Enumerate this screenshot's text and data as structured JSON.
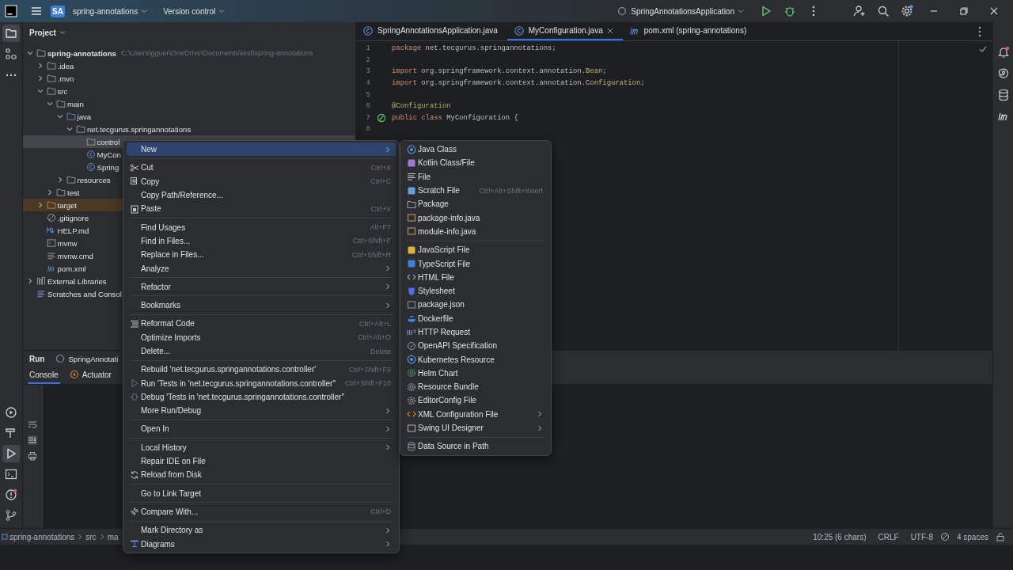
{
  "topbar": {
    "project_badge": "SA",
    "project": "spring-annotations",
    "vcs": "Version control",
    "run_config": "SpringAnnotationsApplication"
  },
  "left_tools": {
    "top": [
      {
        "selected": true
      },
      {
        "selected": false
      }
    ],
    "bottom": [
      {
        "selected": false
      },
      {
        "selected": false
      },
      {
        "selected": true
      },
      {
        "selected": false
      },
      {
        "selected": false
      },
      {
        "selected": false
      }
    ]
  },
  "project_panel": {
    "title": "Project",
    "tree": [
      {
        "name": "spring-annotations",
        "path": "C:\\Users\\gguer\\OneDrive\\Documents\\test\\spring-annotations",
        "kind": "module",
        "expanded": true,
        "selected": false,
        "children": [
          {
            "name": ".idea",
            "kind": "folder",
            "expanded": false,
            "selected": false
          },
          {
            "name": ".mvn",
            "kind": "folder",
            "expanded": false,
            "selected": false
          },
          {
            "name": "src",
            "kind": "folder",
            "expanded": true,
            "selected": false,
            "children": [
              {
                "name": "main",
                "kind": "folder",
                "expanded": true,
                "selected": false,
                "children": [
                  {
                    "name": "java",
                    "kind": "source",
                    "expanded": true,
                    "selected": false,
                    "children": [
                      {
                        "name": "net.tecgurus.springannotations",
                        "kind": "package",
                        "expanded": true,
                        "selected": false,
                        "children": [
                          {
                            "name": "control",
                            "kind": "package",
                            "selected": true
                          },
                          {
                            "name": "MyCon",
                            "kind": "class",
                            "selected": false
                          },
                          {
                            "name": "Spring",
                            "kind": "spring",
                            "selected": false
                          }
                        ]
                      }
                    ]
                  },
                  {
                    "name": "resources",
                    "kind": "resources",
                    "expanded": false,
                    "selected": false
                  }
                ]
              },
              {
                "name": "test",
                "kind": "folder",
                "expanded": false,
                "selected": false
              }
            ]
          },
          {
            "name": "target",
            "kind": "excluded",
            "expanded": false,
            "selected": false
          },
          {
            "name": ".gitignore",
            "kind": "ignore",
            "selected": false
          },
          {
            "name": "HELP.md",
            "kind": "markdown",
            "selected": false
          },
          {
            "name": "mvnw",
            "kind": "script",
            "selected": false
          },
          {
            "name": "mvnw.cmd",
            "kind": "text",
            "selected": false
          },
          {
            "name": "pom.xml",
            "kind": "maven",
            "selected": false
          }
        ]
      },
      {
        "name": "External Libraries",
        "kind": "library",
        "expanded": false,
        "selected": false
      },
      {
        "name": "Scratches and Consol",
        "kind": "scratches",
        "selected": false
      }
    ]
  },
  "editor": {
    "tabs": [
      {
        "label": "SpringAnnotationsApplication.java",
        "kind": "spring",
        "selected": false
      },
      {
        "label": "MyConfiguration.java",
        "kind": "class",
        "selected": true
      },
      {
        "label": "pom.xml (spring-annotations)",
        "kind": "maven",
        "selected": false
      }
    ],
    "lines": [
      {
        "number": "1",
        "tokens": [
          {
            "text": "package ",
            "kind": "keyword"
          },
          {
            "text": "net.tecgurus.springannotations;",
            "kind": "plain"
          }
        ]
      },
      {
        "number": "2"
      },
      {
        "number": "3",
        "tokens": [
          {
            "text": "import ",
            "kind": "keyword"
          },
          {
            "text": "org.springframework.context.annotation.",
            "kind": "plain"
          },
          {
            "text": "Bean",
            "kind": "type"
          },
          {
            "text": ";",
            "kind": "plain"
          }
        ]
      },
      {
        "number": "4",
        "tokens": [
          {
            "text": "import ",
            "kind": "keyword"
          },
          {
            "text": "org.springframework.context.annotation.",
            "kind": "plain"
          },
          {
            "text": "Configuration",
            "kind": "type"
          },
          {
            "text": ";",
            "kind": "plain"
          }
        ]
      },
      {
        "number": "5"
      },
      {
        "number": "6",
        "tokens": [
          {
            "text": "@Configuration",
            "kind": "annotation"
          }
        ]
      },
      {
        "number": "7",
        "tokens": [
          {
            "text": "public class ",
            "kind": "keyword"
          },
          {
            "text": "MyConfiguration {",
            "kind": "plain"
          }
        ],
        "bean": true
      },
      {
        "number": "8"
      }
    ]
  },
  "run_panel": {
    "title": "Run",
    "run_tab": "SpringAnnotati",
    "tabs": [
      {
        "label": "Console",
        "selected": true
      },
      {
        "label": "Actuator",
        "selected": false
      }
    ]
  },
  "status_bar": {
    "breadcrumbs": [
      "spring-annotations",
      "src",
      "ma"
    ],
    "position": "10:25 (6 chars)",
    "line_separator": "CRLF",
    "encoding": "UTF-8",
    "indent": "4 spaces"
  },
  "context_menu": {
    "items": [
      {
        "kind": "item",
        "label": "New",
        "submenu": true,
        "selected": true
      },
      {
        "kind": "separator"
      },
      {
        "kind": "item",
        "label": "Cut",
        "shortcut": "Ctrl+X",
        "submenu": false,
        "selected": false
      },
      {
        "kind": "item",
        "label": "Copy",
        "shortcut": "Ctrl+C",
        "submenu": false,
        "selected": false
      },
      {
        "kind": "item",
        "label": "Copy Path/Reference...",
        "submenu": false,
        "selected": false
      },
      {
        "kind": "item",
        "label": "Paste",
        "shortcut": "Ctrl+V",
        "submenu": false,
        "selected": false
      },
      {
        "kind": "separator"
      },
      {
        "kind": "item",
        "label": "Find Usages",
        "shortcut": "Alt+F7",
        "submenu": false,
        "selected": false
      },
      {
        "kind": "item",
        "label": "Find in Files...",
        "shortcut": "Ctrl+Shift+F",
        "submenu": false,
        "selected": false
      },
      {
        "kind": "item",
        "label": "Replace in Files...",
        "shortcut": "Ctrl+Shift+R",
        "submenu": false,
        "selected": false
      },
      {
        "kind": "item",
        "label": "Analyze",
        "submenu": true,
        "selected": false
      },
      {
        "kind": "separator"
      },
      {
        "kind": "item",
        "label": "Refactor",
        "submenu": true,
        "selected": false
      },
      {
        "kind": "separator"
      },
      {
        "kind": "item",
        "label": "Bookmarks",
        "submenu": true,
        "selected": false
      },
      {
        "kind": "separator"
      },
      {
        "kind": "item",
        "label": "Reformat Code",
        "shortcut": "Ctrl+Alt+L",
        "submenu": false,
        "selected": false
      },
      {
        "kind": "item",
        "label": "Optimize Imports",
        "shortcut": "Ctrl+Alt+O",
        "submenu": false,
        "selected": false
      },
      {
        "kind": "item",
        "label": "Delete...",
        "shortcut": "Delete",
        "submenu": false,
        "selected": false
      },
      {
        "kind": "separator"
      },
      {
        "kind": "item",
        "label": "Rebuild 'net.tecgurus.springannotations.controller'",
        "shortcut": "Ctrl+Shift+F9",
        "submenu": false,
        "selected": false
      },
      {
        "kind": "item",
        "label": "Run 'Tests in 'net.tecgurus.springannotations.controller''",
        "shortcut": "Ctrl+Shift+F10",
        "submenu": false,
        "selected": false
      },
      {
        "kind": "item",
        "label": "Debug 'Tests in 'net.tecgurus.springannotations.controller''",
        "submenu": false,
        "selected": false
      },
      {
        "kind": "item",
        "label": "More Run/Debug",
        "submenu": true,
        "selected": false
      },
      {
        "kind": "separator"
      },
      {
        "kind": "item",
        "label": "Open In",
        "submenu": true,
        "selected": false
      },
      {
        "kind": "separator"
      },
      {
        "kind": "item",
        "label": "Local History",
        "submenu": true,
        "selected": false
      },
      {
        "kind": "item",
        "label": "Repair IDE on File",
        "submenu": false,
        "selected": false
      },
      {
        "kind": "item",
        "label": "Reload from Disk",
        "submenu": false,
        "selected": false
      },
      {
        "kind": "separator"
      },
      {
        "kind": "item",
        "label": "Go to Link Target",
        "submenu": false,
        "selected": false
      },
      {
        "kind": "separator"
      },
      {
        "kind": "item",
        "label": "Compare With...",
        "shortcut": "Ctrl+D",
        "submenu": false,
        "selected": false
      },
      {
        "kind": "separator"
      },
      {
        "kind": "item",
        "label": "Mark Directory as",
        "submenu": true,
        "selected": false
      },
      {
        "kind": "item",
        "label": "Diagrams",
        "submenu": true,
        "selected": false
      }
    ]
  },
  "new_submenu": {
    "items": [
      {
        "kind": "item",
        "label": "Java Class",
        "submenu": false,
        "selected": false
      },
      {
        "kind": "item",
        "label": "Kotlin Class/File",
        "submenu": false,
        "selected": false
      },
      {
        "kind": "item",
        "label": "File",
        "submenu": false,
        "selected": false
      },
      {
        "kind": "item",
        "label": "Scratch File",
        "shortcut": "Ctrl+Alt+Shift+Insert",
        "submenu": false,
        "selected": false
      },
      {
        "kind": "item",
        "label": "Package",
        "submenu": false,
        "selected": false
      },
      {
        "kind": "item",
        "label": "package-info.java",
        "submenu": false,
        "selected": false
      },
      {
        "kind": "item",
        "label": "module-info.java",
        "submenu": false,
        "selected": false
      },
      {
        "kind": "separator"
      },
      {
        "kind": "item",
        "label": "JavaScript File",
        "submenu": false,
        "selected": false
      },
      {
        "kind": "item",
        "label": "TypeScript File",
        "submenu": false,
        "selected": false
      },
      {
        "kind": "item",
        "label": "HTML File",
        "submenu": false,
        "selected": false
      },
      {
        "kind": "item",
        "label": "Stylesheet",
        "submenu": false,
        "selected": false
      },
      {
        "kind": "item",
        "label": "package.json",
        "submenu": false,
        "selected": false
      },
      {
        "kind": "item",
        "label": "Dockerfile",
        "submenu": false,
        "selected": false
      },
      {
        "kind": "item",
        "label": "HTTP Request",
        "submenu": false,
        "selected": false
      },
      {
        "kind": "item",
        "label": "OpenAPI Specification",
        "submenu": false,
        "selected": false
      },
      {
        "kind": "item",
        "label": "Kubernetes Resource",
        "submenu": false,
        "selected": false
      },
      {
        "kind": "item",
        "label": "Helm Chart",
        "submenu": false,
        "selected": false
      },
      {
        "kind": "item",
        "label": "Resource Bundle",
        "submenu": false,
        "selected": false
      },
      {
        "kind": "item",
        "label": "EditorConfig File",
        "submenu": false,
        "selected": false
      },
      {
        "kind": "item",
        "label": "XML Configuration File",
        "submenu": true,
        "selected": false
      },
      {
        "kind": "item",
        "label": "Swing UI Designer",
        "submenu": true,
        "selected": false
      },
      {
        "kind": "separator"
      },
      {
        "kind": "item",
        "label": "Data Source in Path",
        "submenu": false,
        "selected": false
      }
    ]
  }
}
